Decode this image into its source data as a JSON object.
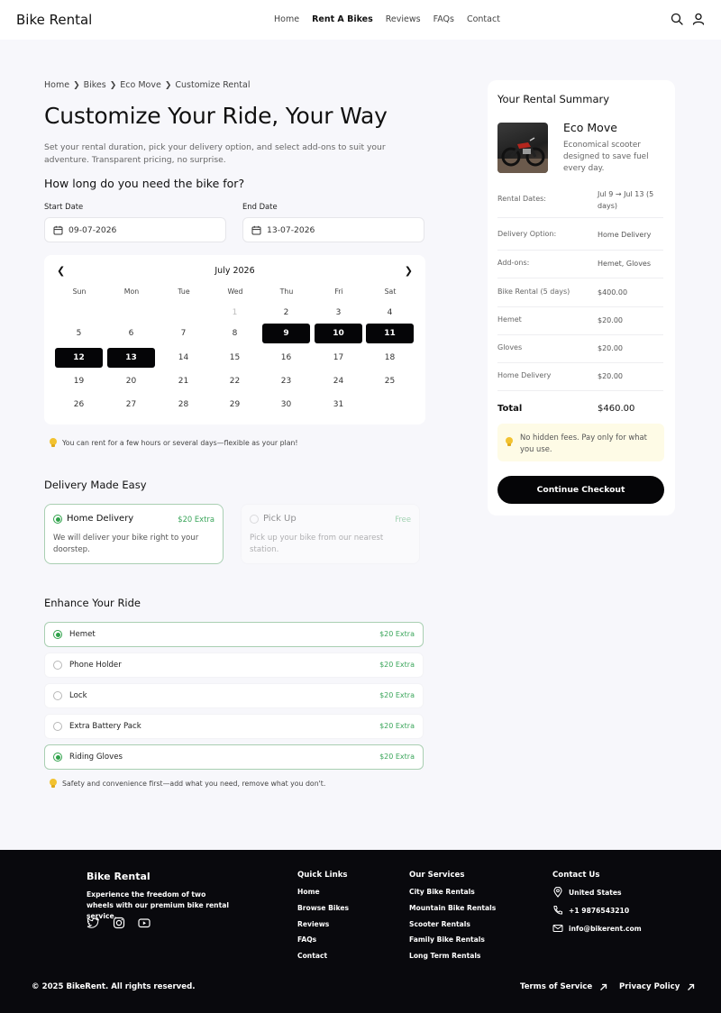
{
  "header": {
    "brand": "Bike Rental",
    "nav": [
      "Home",
      "Rent A Bikes",
      "Reviews",
      "FAQs",
      "Contact"
    ],
    "active_nav": "Rent A Bikes"
  },
  "breadcrumb": [
    "Home",
    "Bikes",
    "Eco Move",
    "Customize Rental"
  ],
  "page": {
    "title": "Customize Your Ride, Your Way",
    "subtitle": "Set your rental duration, pick your delivery option, and select add-ons to suit your adventure. Transparent pricing, no surprise."
  },
  "duration": {
    "heading": "How long do you need the bike for?",
    "start_label": "Start Date",
    "start_value": "09-07-2026",
    "end_label": "End Date",
    "end_value": "13-07-2026"
  },
  "calendar": {
    "month": "July 2026",
    "weekdays": [
      "Sun",
      "Mon",
      "Tue",
      "Wed",
      "Thu",
      "Fri",
      "Sat"
    ],
    "rows": [
      [
        null,
        null,
        null,
        "1",
        "2",
        "3",
        "4"
      ],
      [
        "5",
        "6",
        "7",
        "8",
        "9",
        "10",
        "11"
      ],
      [
        "12",
        "13",
        "14",
        "15",
        "16",
        "17",
        "18"
      ],
      [
        "19",
        "20",
        "21",
        "22",
        "23",
        "24",
        "25"
      ],
      [
        "26",
        "27",
        "28",
        "29",
        "30",
        "31",
        null
      ]
    ],
    "selected": [
      "9",
      "10",
      "11",
      "12",
      "13"
    ],
    "muted": [
      "1"
    ],
    "tip": "You can rent for a few hours or several days—flexible as your plan!"
  },
  "delivery": {
    "heading": "Delivery Made Easy",
    "options": [
      {
        "title": "Home Delivery",
        "price": "$20 Extra",
        "desc": "We will deliver your bike right to your doorstep.",
        "selected": true
      },
      {
        "title": "Pick Up",
        "price": "Free",
        "desc": "Pick up your bike from our nearest station.",
        "selected": false
      }
    ]
  },
  "addons": {
    "heading": "Enhance Your Ride",
    "items": [
      {
        "name": "Hemet",
        "price": "$20 Extra",
        "selected": true
      },
      {
        "name": "Phone Holder",
        "price": "$20 Extra",
        "selected": false
      },
      {
        "name": "Lock",
        "price": "$20 Extra",
        "selected": false
      },
      {
        "name": "Extra Battery Pack",
        "price": "$20 Extra",
        "selected": false
      },
      {
        "name": "Riding Gloves",
        "price": "$20 Extra",
        "selected": true
      }
    ],
    "tip": "Safety and convenience first—add what you need, remove what you don't."
  },
  "summary": {
    "title": "Your Rental Summary",
    "bike_name": "Eco Move",
    "bike_desc": "Economical scooter designed to save fuel every day.",
    "rows": [
      {
        "key": "Rental Dates:",
        "value": "Jul 9 → Jul 13 (5 days)"
      },
      {
        "key": "Delivery Option:",
        "value": "Home Delivery"
      },
      {
        "key": "Add-ons:",
        "value": "Hemet, Gloves"
      },
      {
        "key": "Bike Rental (5 days)",
        "value": "$400.00"
      },
      {
        "key": "Hemet",
        "value": "$20.00"
      },
      {
        "key": "Gloves",
        "value": "$20.00"
      },
      {
        "key": "Home Delivery",
        "value": "$20.00"
      }
    ],
    "total_label": "Total",
    "total_value": "$460.00",
    "note": "No hidden fees. Pay only for what you use.",
    "cta": "Continue Checkout"
  },
  "footer": {
    "brand": "Bike Rental",
    "tagline": "Experience the freedom of two wheels with our premium bike rental service.",
    "social_icons": [
      "twitter-icon",
      "instagram-icon",
      "youtube-icon"
    ],
    "quick_links_title": "Quick Links",
    "quick_links": [
      "Home",
      "Browse Bikes",
      "Reviews",
      "FAQs",
      "Contact"
    ],
    "services_title": "Our Services",
    "services": [
      "City Bike Rentals",
      "Mountain Bike Rentals",
      "Scooter Rentals",
      "Family Bike Rentals",
      "Long Term Rentals"
    ],
    "contact_title": "Contact Us",
    "contact": {
      "location": "United States",
      "phone": "+1 9876543210",
      "email": "info@bikerent.com"
    },
    "copyright": "© 2025 BikeRent. All rights reserved.",
    "terms": "Terms of Service",
    "privacy": "Privacy Policy"
  },
  "colors": {
    "accent_green": "#2fa24a",
    "primary_dark": "#050507",
    "background": "#f7f7fb",
    "note_bg": "#fefbe6"
  }
}
